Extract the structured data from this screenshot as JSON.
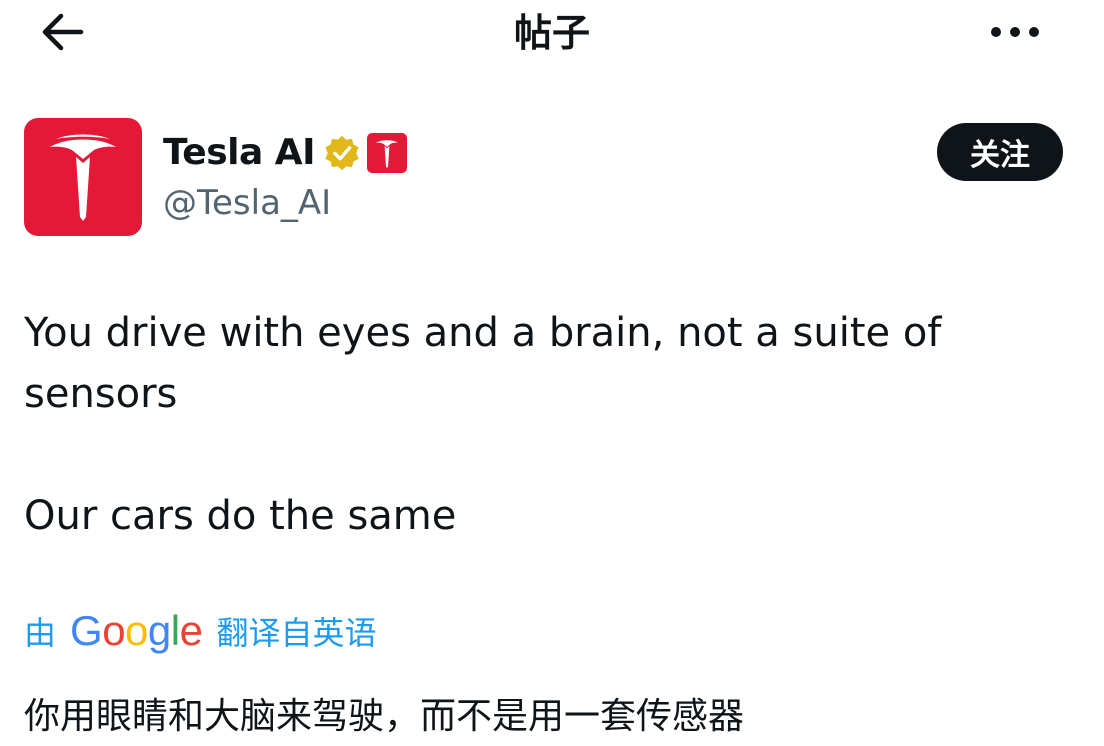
{
  "header": {
    "title": "帖子",
    "back_icon": "arrow-left-icon",
    "more_icon": "more-horizontal-icon"
  },
  "author": {
    "display_name": "Tesla AI",
    "handle": "@Tesla_AI",
    "verified_badge_color": "#e2b719",
    "brand_color": "#e31937",
    "follow_label": "关注"
  },
  "post": {
    "lines": [
      "You drive with eyes and a brain, not a suite of",
      "sensors",
      "Our cars do the same"
    ]
  },
  "translation": {
    "prefix": "由",
    "provider": "Google",
    "suffix": "翻译自英语",
    "text": "你用眼睛和大脑来驾驶，而不是用一套传感器",
    "link_color": "#1d9bf0"
  }
}
